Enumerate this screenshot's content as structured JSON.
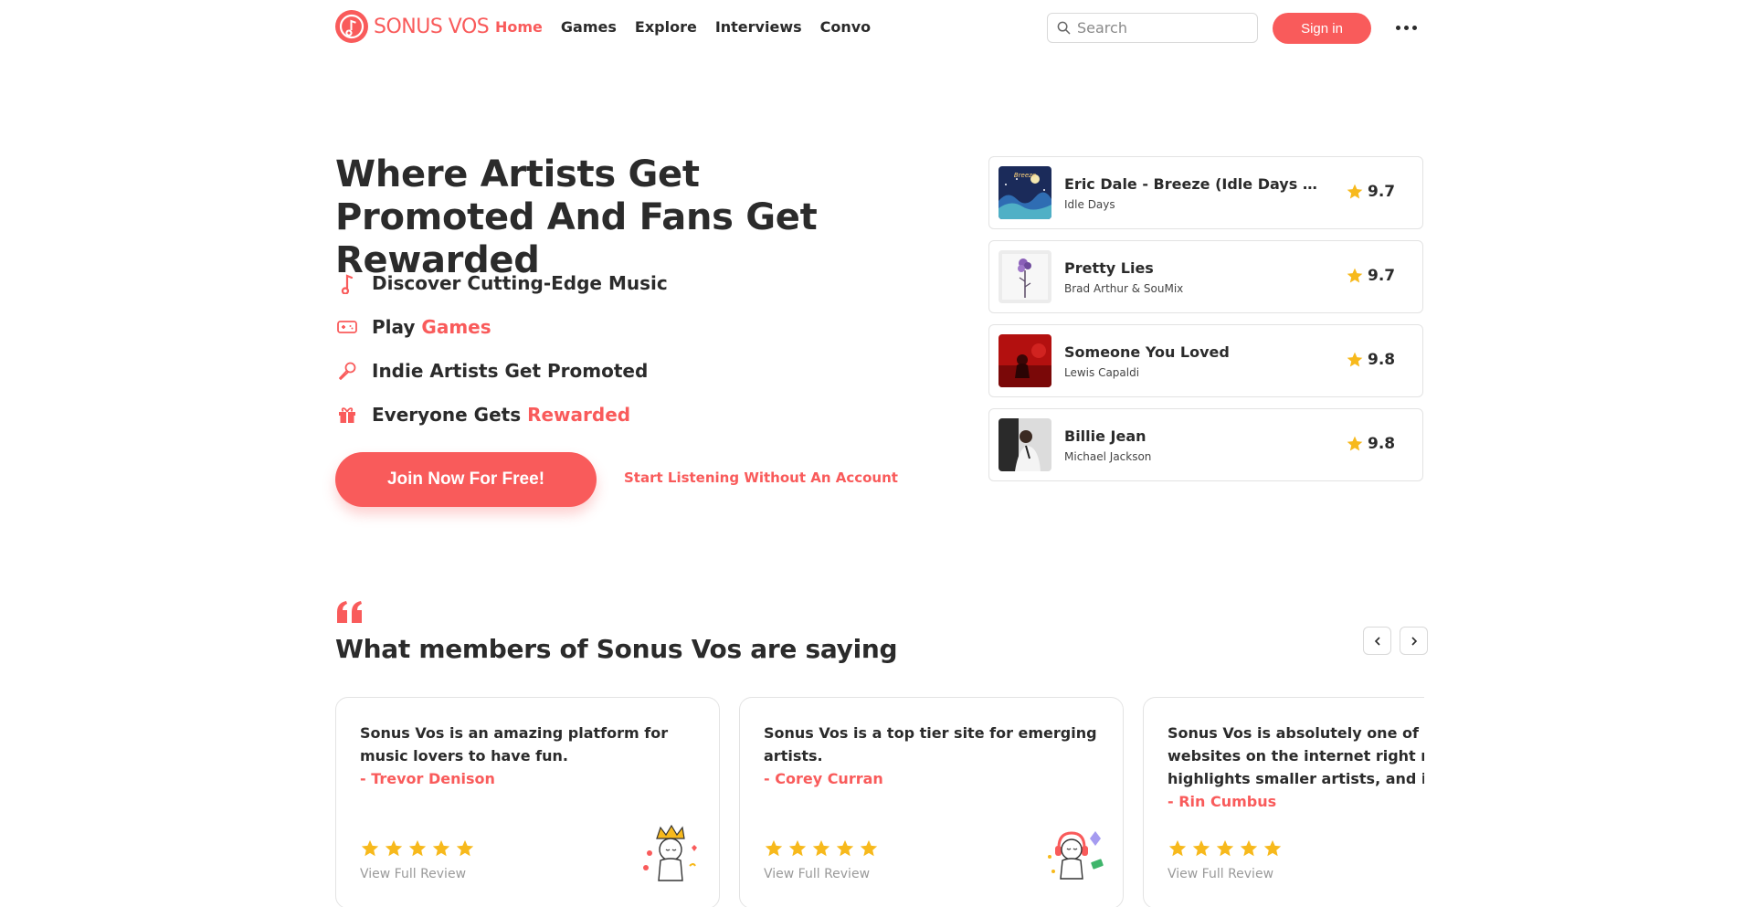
{
  "header": {
    "logo_text": "SONUS VOS",
    "nav": [
      "Home",
      "Games",
      "Explore",
      "Interviews",
      "Convo"
    ],
    "active_nav": "Home",
    "search_placeholder": "Search",
    "signin_label": "Sign in"
  },
  "hero": {
    "title": "Where Artists Get Promoted And Fans Get Rewarded",
    "features": [
      {
        "icon": "music-note-icon",
        "text": "Discover Cutting-Edge Music",
        "accent": ""
      },
      {
        "icon": "gamepad-icon",
        "text": "Play ",
        "accent": "Games"
      },
      {
        "icon": "microphone-icon",
        "text": "Indie Artists Get Promoted",
        "accent": ""
      },
      {
        "icon": "gift-icon",
        "text": "Everyone Gets ",
        "accent": "Rewarded"
      }
    ],
    "join_label": "Join Now For Free!",
    "listen_label": "Start Listening Without An Account"
  },
  "tracks": [
    {
      "title": "Eric Dale - Breeze (Idle Days Cov...",
      "artist": "Idle Days",
      "rating": "9.7",
      "cover": "cover-breeze"
    },
    {
      "title": "Pretty Lies",
      "artist": "Brad Arthur & SouMix",
      "rating": "9.7",
      "cover": "cover-pretty-lies"
    },
    {
      "title": "Someone You Loved",
      "artist": "Lewis Capaldi",
      "rating": "9.8",
      "cover": "cover-someone-you-loved"
    },
    {
      "title": "Billie Jean",
      "artist": "Michael Jackson",
      "rating": "9.8",
      "cover": "cover-billie-jean"
    }
  ],
  "testimonials": {
    "title": "What members of Sonus Vos are saying",
    "link_label": "View Full Review",
    "stars": 5,
    "reviews": [
      {
        "text": "Sonus Vos is an amazing platform for music lovers to have fun.",
        "author": "- Trevor Denison",
        "mascot": "crown-mascot-icon"
      },
      {
        "text": "Sonus Vos is a top tier site for emerging artists.",
        "author": "- Corey Curran",
        "mascot": "headphones-mascot-icon"
      },
      {
        "text": "Sonus Vos is absolutely one of my f websites on the internet right now. highlights smaller artists, and is tru",
        "author": "- Rin Cumbus",
        "mascot": ""
      }
    ]
  },
  "colors": {
    "accent": "#f95b5b",
    "text": "#2b2b2b",
    "star": "#f7b91c"
  }
}
